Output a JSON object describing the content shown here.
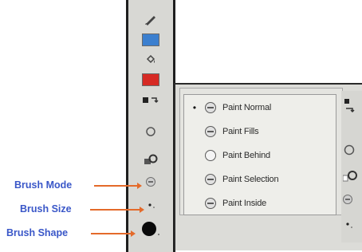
{
  "toolbar": {
    "colors": {
      "stroke_swatch": "#3b7fcf",
      "fill_swatch": "#d62a24",
      "frame": "#1e1e1e"
    },
    "icons": [
      "pencil-icon",
      "stroke-color-swatch",
      "paint-bucket-icon",
      "fill-color-swatch",
      "swap-colors-icon",
      "object-drawing-icon",
      "lock-fill-icon",
      "brush-mode-icon",
      "brush-size-icon",
      "brush-shape-icon"
    ]
  },
  "callouts": {
    "brush_mode": "Brush Mode",
    "brush_size": "Brush Size",
    "brush_shape": "Brush Shape",
    "arrow_color": "#e46a2a",
    "label_color": "#3a57c8"
  },
  "popup": {
    "items": [
      {
        "label": "Paint Normal",
        "selected": true
      },
      {
        "label": "Paint Fills",
        "selected": false
      },
      {
        "label": "Paint Behind",
        "selected": false
      },
      {
        "label": "Paint Selection",
        "selected": false
      },
      {
        "label": "Paint Inside",
        "selected": false
      }
    ],
    "check_mark": "•"
  }
}
